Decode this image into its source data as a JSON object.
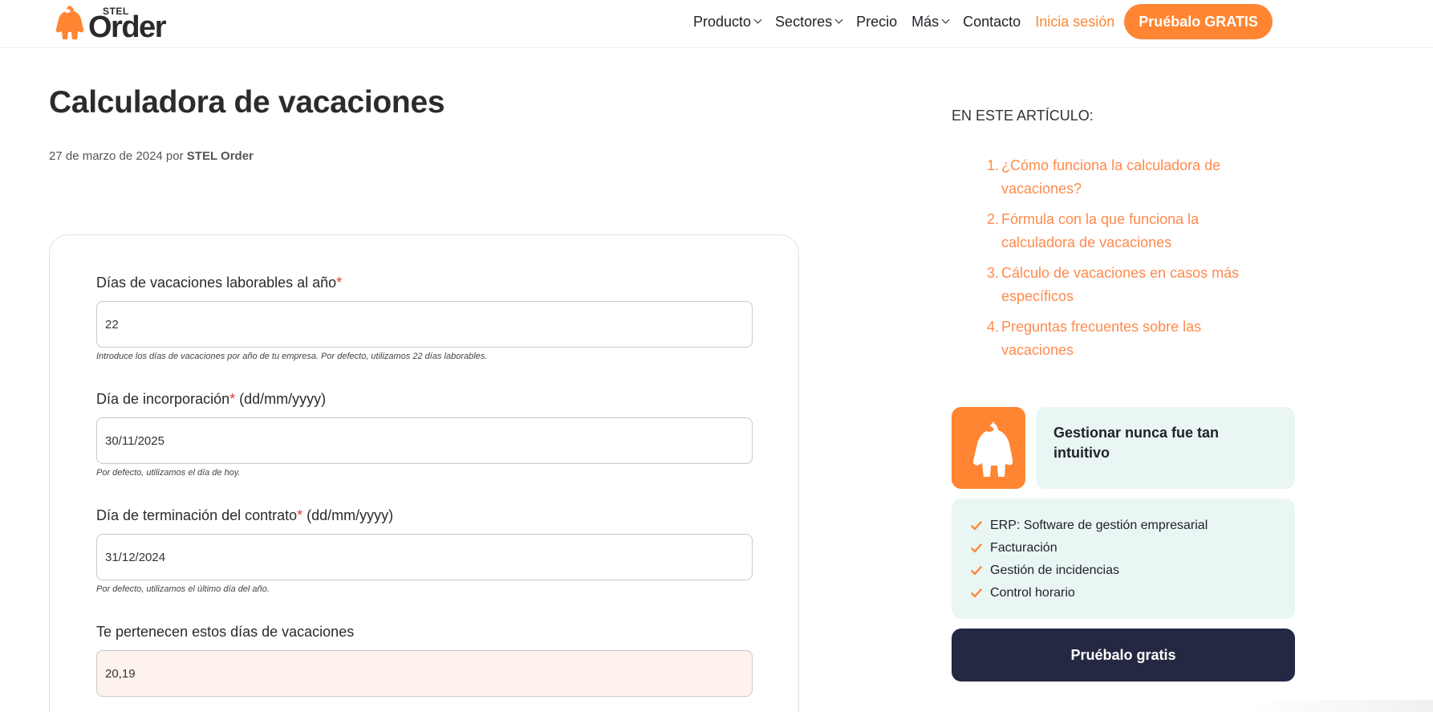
{
  "header": {
    "logo": {
      "small": "STEL",
      "big": "Order"
    },
    "nav": [
      {
        "label": "Producto",
        "has_menu": true
      },
      {
        "label": "Sectores",
        "has_menu": true
      },
      {
        "label": "Precio",
        "has_menu": false
      },
      {
        "label": "Más",
        "has_menu": true
      },
      {
        "label": "Contacto",
        "has_menu": false
      }
    ],
    "login_label": "Inicia sesión",
    "cta_label": "Pruébalo GRATIS"
  },
  "article": {
    "title": "Calculadora de vacaciones",
    "date_prefix": "27 de marzo de 2024 por",
    "author": "STEL Order"
  },
  "form": {
    "fields": [
      {
        "label": "Días de vacaciones laborables al año",
        "required_mark": "*",
        "suffix": "",
        "value": "22",
        "help": "Introduce los días de vacaciones por año de tu empresa. Por defecto, utilizamos 22 días laborables."
      },
      {
        "label": "Día de incorporación",
        "required_mark": "*",
        "suffix": " (dd/mm/yyyy)",
        "value": "30/11/2025",
        "help": "Por defecto, utilizamos el día de hoy."
      },
      {
        "label": "Día de terminación del contrato",
        "required_mark": "*",
        "suffix": " (dd/mm/yyyy)",
        "value": "31/12/2024",
        "help": "Por defecto, utilizamos el último día del año."
      },
      {
        "label": "Te pertenecen estos días de vacaciones",
        "required_mark": "",
        "suffix": "",
        "value": "20,19",
        "help": ""
      }
    ]
  },
  "sidebar": {
    "toc_heading": "EN ESTE ARTÍCULO:",
    "toc": [
      {
        "num": "1.",
        "label": "¿Cómo funciona la calculadora de vacaciones?"
      },
      {
        "num": "2.",
        "label": "Fórmula con la que funciona la calculadora de vacaciones"
      },
      {
        "num": "3.",
        "label": "Cálculo de vacaciones en casos más específicos"
      },
      {
        "num": "4.",
        "label": "Preguntas frecuentes sobre las vacaciones"
      }
    ],
    "promo": {
      "headline": "Gestionar nunca fue tan intuitivo",
      "features": [
        "ERP: Software de gestión empresarial",
        "Facturación",
        "Gestión de incidencias",
        "Control horario"
      ],
      "cta_label": "Pruébalo gratis"
    }
  },
  "colors": {
    "brand_orange": "#ff8533",
    "link_orange": "#ff8a4c",
    "dark_navy": "#252842",
    "mint_bg": "#e9f6f3",
    "result_bg": "#fdf3ec",
    "required_red": "#e53935"
  },
  "icons": [
    "gorilla-logo-icon",
    "chevron-down-icon",
    "checkmark-icon",
    "gorilla-promo-icon"
  ]
}
